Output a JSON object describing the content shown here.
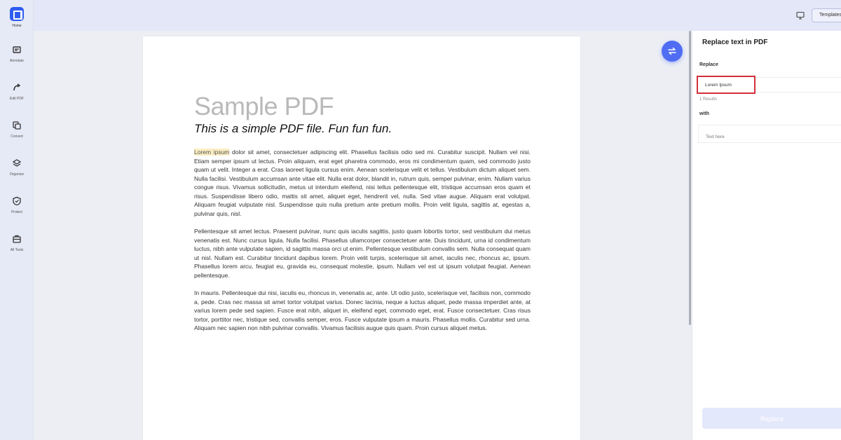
{
  "sidebar": {
    "home_label": "Home",
    "items": [
      {
        "label": "Annotate",
        "icon": "annotate-icon"
      },
      {
        "label": "Edit PDF",
        "icon": "edit-icon"
      },
      {
        "label": "Convert",
        "icon": "convert-icon"
      },
      {
        "label": "Organize",
        "icon": "organize-icon"
      },
      {
        "label": "Protect",
        "icon": "protect-icon"
      },
      {
        "label": "All Tools",
        "icon": "toolbox-icon"
      }
    ]
  },
  "topbar": {
    "template_label": "Templates"
  },
  "document": {
    "title": "Sample PDF",
    "subtitle": "This is a simple PDF file. Fun fun fun.",
    "highlight": "Lorem ipsum",
    "p1_rest": " dolor sit amet, consectetuer adipiscing elit. Phasellus facilisis odio sed mi. Curabitur suscipit. Nullam vel nisi. Etiam semper ipsum ut lectus. Proin aliquam, erat eget pharetra commodo, eros mi condimentum quam, sed commodo justo quam ut velit. Integer a erat. Cras laoreet ligula cursus enim. Aenean scelerisque velit et tellus. Vestibulum dictum aliquet sem. Nulla facilisi. Vestibulum accumsan ante vitae elit. Nulla erat dolor, blandit in, rutrum quis, semper pulvinar, enim. Nullam varius congue risus. Vivamus sollicitudin, metus ut interdum eleifend, nisi tellus pellentesque elit, tristique accumsan eros quam et risus. Suspendisse libero odio, mattis sit amet, aliquet eget, hendrerit vel, nulla. Sed vitae augue. Aliquam erat volutpat. Aliquam feugiat vulputate nisl. Suspendisse quis nulla pretium ante pretium mollis. Proin velit ligula, sagittis at, egestas a, pulvinar quis, nisl.",
    "p2": "Pellentesque sit amet lectus. Praesent pulvinar, nunc quis iaculis sagittis, justo quam lobortis tortor, sed vestibulum dui metus venenatis est. Nunc cursus ligula. Nulla facilisi. Phasellus ullamcorper consectetuer ante. Duis tincidunt, urna id condimentum luctus, nibh ante vulputate sapien, id sagittis massa orci ut enim. Pellentesque vestibulum convallis sem. Nulla consequat quam ut nisl. Nullam est. Curabitur tincidunt dapibus lorem. Proin velit turpis, scelerisque sit amet, iaculis nec, rhoncus ac, ipsum. Phasellus lorem arcu, feugiat eu, gravida eu, consequat molestie, ipsum. Nullam vel est ut ipsum volutpat feugiat. Aenean pellentesque.",
    "p3": "In mauris. Pellentesque dui nisi, iaculis eu, rhoncus in, venenatis ac, ante. Ut odio justo, scelerisque vel, facilisis non, commodo a, pede. Cras nec massa sit amet tortor volutpat varius. Donec lacinia, neque a luctus aliquet, pede massa imperdiet ante, at varius lorem pede sed sapien. Fusce erat nibh, aliquet in, eleifend eget, commodo eget, erat. Fusce consectetuer. Cras risus tortor, porttitor nec, tristique sed, convallis semper, eros. Fusce vulputate ipsum a mauris. Phasellus mollis. Curabitur sed urna. Aliquam nec sapien non nibh pulvinar convallis. Vivamus facilisis augue quis quam. Proin cursus aliquet metus."
  },
  "panel": {
    "title": "Replace text in PDF",
    "replace_label": "Replace",
    "find_value": "Lorem Ipsum",
    "results_text": "1 Results",
    "with_label": "with",
    "with_placeholder": "Text here",
    "replace_button": "Replace"
  },
  "colors": {
    "accent": "#4f6cf3",
    "highlight": "#fbeec2",
    "focus_border": "#d2303a"
  }
}
